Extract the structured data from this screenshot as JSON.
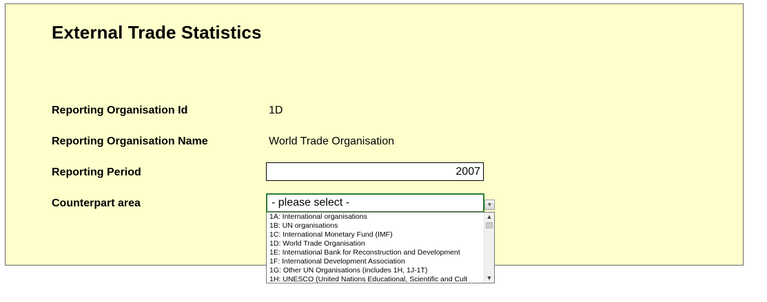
{
  "title": "External Trade Statistics",
  "fields": {
    "org_id_label": "Reporting Organisation Id",
    "org_id_value": "1D",
    "org_name_label": "Reporting Organisation Name",
    "org_name_value": "World Trade Organisation",
    "period_label": "Reporting Period",
    "period_value": "2007",
    "counterpart_label": "Counterpart area",
    "counterpart_value": "- please select -"
  },
  "dropdown": {
    "items": [
      "1A: International organisations",
      "1B: UN organisations",
      "1C: International Monetary Fund (IMF)",
      "1D: World Trade Organisation",
      "1E: International Bank for Reconstruction and Development",
      "1F: International Development Association",
      "1G: Other UN Organisations (includes 1H, 1J-1T)",
      "1H: UNESCO (United Nations Educational, Scientific and Cult"
    ],
    "scroll_up_icon": "chevron-up-icon",
    "scroll_down_icon": "chevron-down-icon"
  },
  "colors": {
    "sheet_background": "#ffffcc",
    "combo_border": "#2e7d32"
  }
}
